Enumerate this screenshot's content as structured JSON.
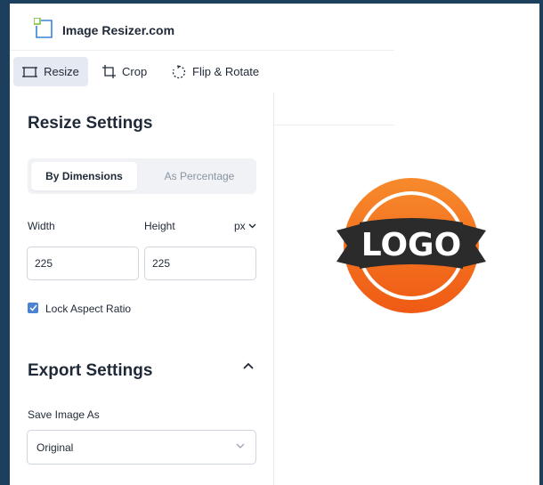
{
  "app": {
    "title": "Image Resizer.com"
  },
  "tabs": [
    {
      "label": "Resize",
      "icon": "resize-icon",
      "active": true
    },
    {
      "label": "Crop",
      "icon": "crop-icon",
      "active": false
    },
    {
      "label": "Flip & Rotate",
      "icon": "rotate-icon",
      "active": false
    }
  ],
  "resize": {
    "heading": "Resize Settings",
    "mode_tabs": [
      "By Dimensions",
      "As Percentage"
    ],
    "width_label": "Width",
    "height_label": "Height",
    "unit": "px",
    "width_value": "225",
    "height_value": "225",
    "lock_aspect": {
      "label": "Lock Aspect Ratio",
      "checked": true
    }
  },
  "export": {
    "heading": "Export Settings",
    "save_as_label": "Save Image As",
    "save_as_value": "Original"
  },
  "preview": {
    "logo_text": "LOGO"
  },
  "colors": {
    "frame": "#1d3f5e",
    "accent": "#4a82d4",
    "logo_orange": "#f26a1b",
    "ribbon": "#2b2b2b"
  }
}
